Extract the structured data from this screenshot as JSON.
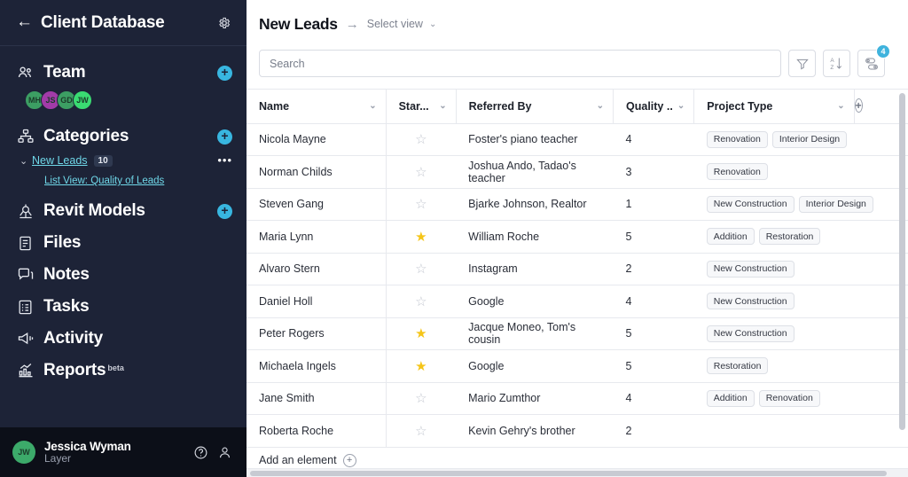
{
  "sidebar": {
    "back_icon": "arrow-left-icon",
    "title": "Client Database",
    "gear_icon": "gear-icon",
    "team": {
      "label": "Team",
      "icon": "people-icon",
      "add_label": "+",
      "members": [
        {
          "initials": "MH",
          "color": "#3c9e63"
        },
        {
          "initials": "JS",
          "color": "#a23ba8"
        },
        {
          "initials": "GD",
          "color": "#3c9e63"
        },
        {
          "initials": "JW",
          "color": "#3adb72"
        }
      ]
    },
    "categories": {
      "label": "Categories",
      "icon": "hierarchy-icon",
      "add_label": "+",
      "caret": "⌄",
      "item_label": "New Leads",
      "item_count": "10",
      "more_label": "•••",
      "sub_item_label": "List View: Quality of Leads"
    },
    "nav": [
      {
        "label": "Revit Models",
        "icon": "revit-icon",
        "add": true
      },
      {
        "label": "Files",
        "icon": "files-icon",
        "add": false
      },
      {
        "label": "Notes",
        "icon": "notes-icon",
        "add": false
      },
      {
        "label": "Tasks",
        "icon": "tasks-icon",
        "add": false
      },
      {
        "label": "Activity",
        "icon": "activity-icon",
        "add": false
      },
      {
        "label": "Reports",
        "icon": "reports-icon",
        "add": false,
        "badge": "beta"
      }
    ],
    "footer": {
      "avatar_initials": "JW",
      "name": "Jessica Wyman",
      "org": "Layer",
      "help_icon": "question-circle-icon",
      "account_icon": "person-icon"
    }
  },
  "header": {
    "title": "New Leads",
    "arrow": "→",
    "select_view": "Select view",
    "caret": "⌄"
  },
  "search": {
    "placeholder": "Search",
    "value": ""
  },
  "toolbar": {
    "filter_icon": "filter-icon",
    "sort_icon": "sort-az-icon",
    "settings_icon": "toggles-icon",
    "settings_badge": "4"
  },
  "table": {
    "columns": [
      {
        "label": "Name",
        "caret": "⌄"
      },
      {
        "label": "Star...",
        "caret": "⌄"
      },
      {
        "label": "Referred By",
        "caret": "⌄"
      },
      {
        "label": "Quality ...",
        "caret": "⌄"
      },
      {
        "label": "Project Type",
        "caret": "⌄"
      }
    ],
    "add_column_label": "+",
    "rows": [
      {
        "name": "Nicola Mayne",
        "starred": false,
        "referred_by": "Foster's piano teacher",
        "quality": "4",
        "project_types": [
          "Renovation",
          "Interior Design"
        ]
      },
      {
        "name": "Norman Childs",
        "starred": false,
        "referred_by": "Joshua Ando, Tadao's teacher",
        "quality": "3",
        "project_types": [
          "Renovation"
        ]
      },
      {
        "name": "Steven Gang",
        "starred": false,
        "referred_by": "Bjarke Johnson, Realtor",
        "quality": "1",
        "project_types": [
          "New Construction",
          "Interior Design"
        ]
      },
      {
        "name": "Maria Lynn",
        "starred": true,
        "referred_by": "William Roche",
        "quality": "5",
        "project_types": [
          "Addition",
          "Restoration"
        ]
      },
      {
        "name": "Alvaro Stern",
        "starred": false,
        "referred_by": "Instagram",
        "quality": "2",
        "project_types": [
          "New Construction"
        ]
      },
      {
        "name": "Daniel Holl",
        "starred": false,
        "referred_by": "Google",
        "quality": "4",
        "project_types": [
          "New Construction"
        ]
      },
      {
        "name": "Peter Rogers",
        "starred": true,
        "referred_by": "Jacque Moneo, Tom's cousin",
        "quality": "5",
        "project_types": [
          "New Construction"
        ]
      },
      {
        "name": "Michaela Ingels",
        "starred": true,
        "referred_by": "Google",
        "quality": "5",
        "project_types": [
          "Restoration"
        ]
      },
      {
        "name": "Jane Smith",
        "starred": false,
        "referred_by": "Mario Zumthor",
        "quality": "4",
        "project_types": [
          "Addition",
          "Renovation"
        ]
      },
      {
        "name": "Roberta Roche",
        "starred": false,
        "referred_by": "Kevin Gehry's brother",
        "quality": "2",
        "project_types": []
      }
    ],
    "add_element_label": "Add an element",
    "add_element_plus": "+"
  },
  "colors": {
    "sidebar_bg": "#1d2337",
    "sidebar_footer_bg": "#0c0f18",
    "accent_blue": "#38b6e0",
    "link_cyan": "#6fd7e8",
    "star_gold": "#f5c518"
  }
}
